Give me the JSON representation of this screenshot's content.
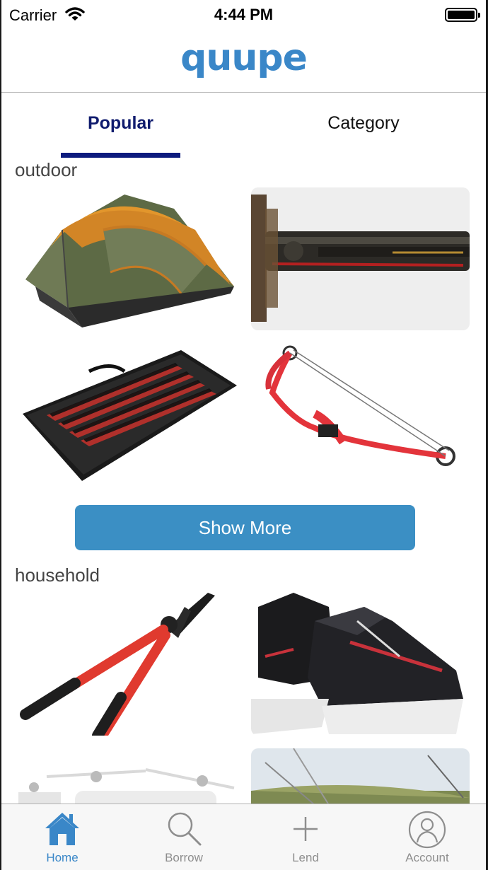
{
  "status": {
    "carrier": "Carrier",
    "time": "4:44 PM"
  },
  "header": {
    "logo": "quupe"
  },
  "tabs": [
    {
      "label": "Popular"
    },
    {
      "label": "Category"
    }
  ],
  "sections": [
    {
      "title": "outdoor",
      "items": [
        "tent-image",
        "rifle-image",
        "keyboard-image",
        "bow-image"
      ]
    },
    {
      "title": "household",
      "items": [
        "hedge-shears-image",
        "ice-skates-image",
        "drone-image",
        "grass-image"
      ]
    }
  ],
  "show_more": "Show More",
  "tabbar": [
    {
      "label": "Home",
      "icon": "home-icon"
    },
    {
      "label": "Borrow",
      "icon": "search-icon"
    },
    {
      "label": "Lend",
      "icon": "plus-icon"
    },
    {
      "label": "Account",
      "icon": "account-icon"
    }
  ],
  "colors": {
    "brand": "#3a87c8",
    "tab_active": "#101c6e",
    "button": "#3b8fc4"
  }
}
